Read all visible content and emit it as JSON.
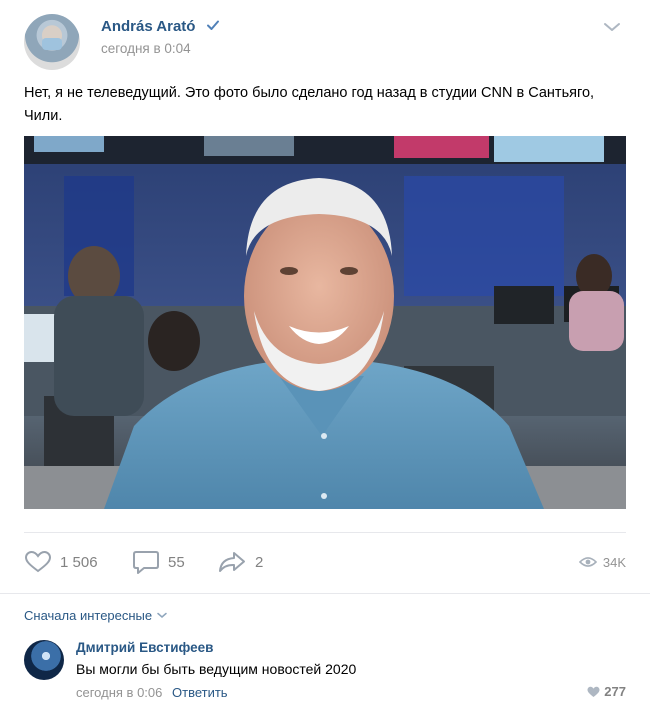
{
  "post": {
    "author": "András Arató",
    "time": "сегодня в 0:04",
    "text": "Нет, я не телеведущий. Это фото было сделано год назад в студии CNN в Сантьяго, Чили."
  },
  "actions": {
    "likes": "1 506",
    "comments": "55",
    "shares": "2",
    "views": "34K"
  },
  "comments_section": {
    "sort_label": "Сначала интересные",
    "comment": {
      "author": "Дмитрий Евстифеев",
      "text": "Вы могли бы быть ведущим новостей 2020",
      "time": "сегодня в 0:06",
      "reply_label": "Ответить",
      "likes": "277"
    }
  },
  "colors": {
    "link": "#2a5885",
    "muted": "#939393",
    "divider": "#e7e8ec"
  }
}
